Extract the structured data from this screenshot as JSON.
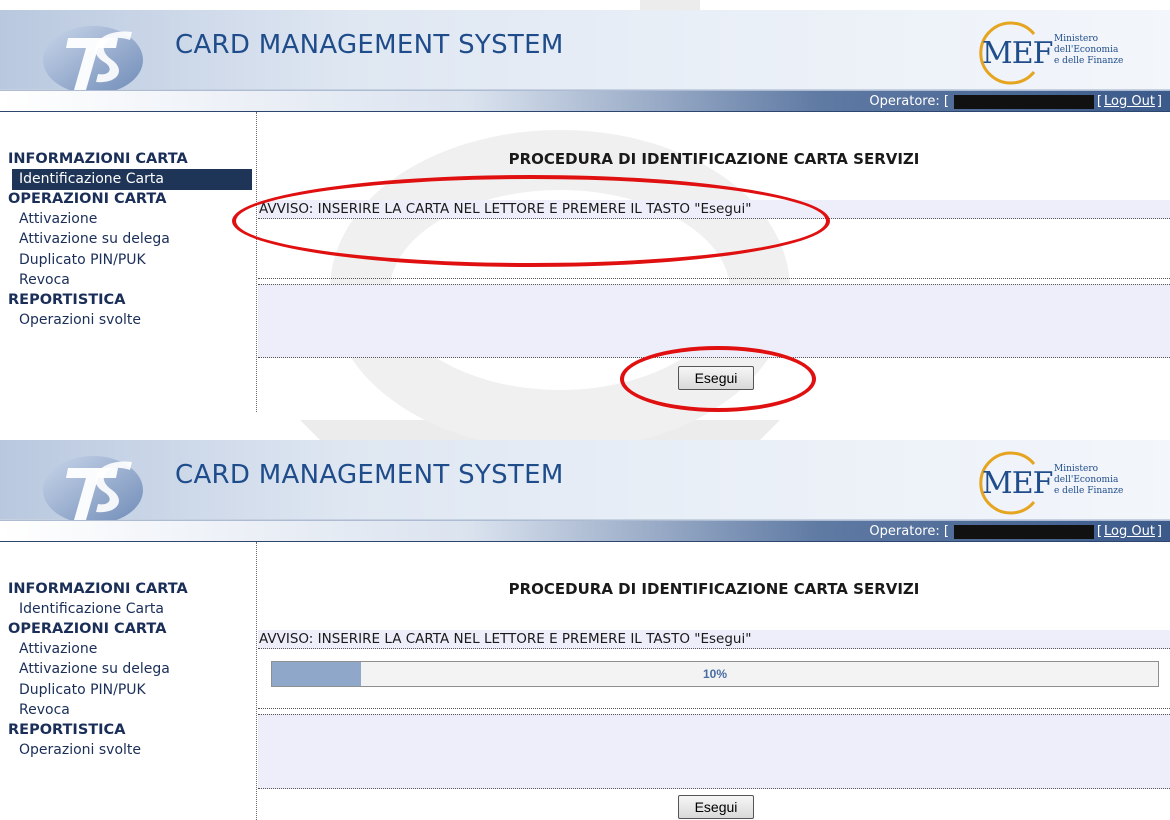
{
  "app": {
    "title": "CARD MANAGEMENT SYSTEM",
    "ts_logo_text": "TS",
    "mef_logo_text": "MEF",
    "ministry_text": "Ministero\ndell'Economia\ne delle Finanze",
    "operator_label": "Operatore: [",
    "logout_label": "Log Out",
    "logout_suffix": "]"
  },
  "sidebar": {
    "sections": [
      {
        "title": "INFORMAZIONI CARTA",
        "items": [
          "Identificazione Carta"
        ]
      },
      {
        "title": "OPERAZIONI CARTA",
        "items": [
          "Attivazione",
          "Attivazione su delega",
          "Duplicato PIN/PUK",
          "Revoca"
        ]
      },
      {
        "title": "REPORTISTICA",
        "items": [
          "Operazioni svolte"
        ]
      }
    ]
  },
  "main": {
    "title": "PROCEDURA DI IDENTIFICAZIONE CARTA SERVIZI",
    "notice": "AVVISO: INSERIRE LA CARTA NEL LETTORE E PREMERE IL TASTO \"Esegui\"",
    "execute_label": "Esegui"
  },
  "panel2": {
    "progress": 0.1,
    "progress_text": "10%"
  },
  "colors": {
    "brand_blue": "#1f4c8a",
    "active_menu": "#1f3558",
    "annotation_red": "#e01010"
  }
}
